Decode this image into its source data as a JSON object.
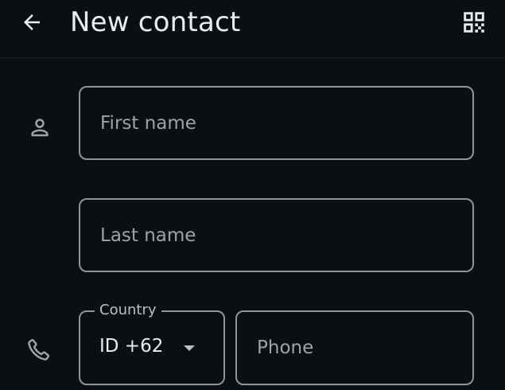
{
  "header": {
    "back_icon": "arrow-left-icon",
    "title": "New contact",
    "qr_icon": "qr-code-icon"
  },
  "form": {
    "first_name": {
      "placeholder": "First name",
      "icon": "person-icon"
    },
    "last_name": {
      "placeholder": "Last name"
    },
    "country": {
      "label": "Country",
      "value": "ID +62",
      "icon": "caret-down-icon"
    },
    "phone": {
      "placeholder": "Phone",
      "icon": "phone-icon"
    }
  },
  "colors": {
    "background": "#0b0f12",
    "border": "#8c9599",
    "text": "#e9edef",
    "placeholder": "#9aa4a9"
  }
}
